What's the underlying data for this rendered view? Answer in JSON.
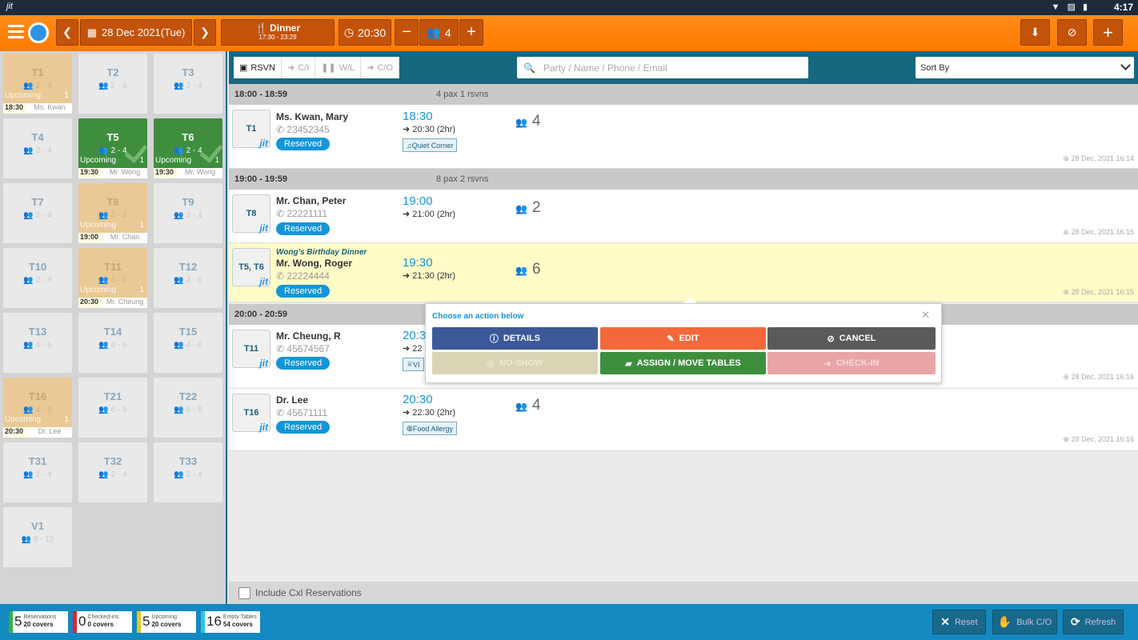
{
  "status_bar": {
    "logo": "jit",
    "time": "4:17",
    "icons": "▼ ▨ ▮"
  },
  "header": {
    "date": "28 Dec 2021(Tue)",
    "meal": "Dinner",
    "meal_hours": "17:30 - 23:29",
    "time": "20:30",
    "party_size": "4"
  },
  "tables": [
    {
      "name": "T1",
      "cap": "2 - 4",
      "state": "Upcoming",
      "count": "1",
      "time": "18:30",
      "guest": "Ms. Kwan",
      "style": "tan"
    },
    {
      "name": "T2",
      "cap": "2 - 4",
      "style": "plain"
    },
    {
      "name": "T3",
      "cap": "2 - 4",
      "style": "plain"
    },
    {
      "name": "T4",
      "cap": "2 - 4",
      "style": "plain"
    },
    {
      "name": "T5",
      "cap": "2 - 4",
      "state": "Upcoming",
      "count": "1",
      "time": "19:30",
      "guest": "Mr. Wong",
      "style": "green"
    },
    {
      "name": "T6",
      "cap": "2 - 4",
      "state": "Upcoming",
      "count": "1",
      "time": "19:30",
      "guest": "Mr. Wong",
      "style": "green"
    },
    {
      "name": "T7",
      "cap": "2 - 4",
      "style": "plain"
    },
    {
      "name": "T8",
      "cap": "2 - 4",
      "state": "Upcoming",
      "count": "1",
      "time": "19:00",
      "guest": "Mr. Chan",
      "style": "tan"
    },
    {
      "name": "T9",
      "cap": "2 - 4",
      "style": "plain"
    },
    {
      "name": "T10",
      "cap": "2 - 4",
      "style": "plain"
    },
    {
      "name": "T11",
      "cap": "4 - 6",
      "state": "Upcoming",
      "count": "1",
      "time": "20:30",
      "guest": "Mr. Cheung",
      "style": "tan"
    },
    {
      "name": "T12",
      "cap": "4 - 6",
      "style": "plain"
    },
    {
      "name": "T13",
      "cap": "4 - 6",
      "style": "plain"
    },
    {
      "name": "T14",
      "cap": "4 - 6",
      "style": "plain"
    },
    {
      "name": "T15",
      "cap": "4 - 6",
      "style": "plain"
    },
    {
      "name": "T16",
      "cap": "4 - 6",
      "state": "Upcoming",
      "count": "1",
      "time": "20:30",
      "guest": "Dr. Lee",
      "style": "tan"
    },
    {
      "name": "T21",
      "cap": "6 - 8",
      "style": "plain"
    },
    {
      "name": "T22",
      "cap": "6 - 8",
      "style": "plain"
    },
    {
      "name": "T31",
      "cap": "2 - 4",
      "style": "plain"
    },
    {
      "name": "T32",
      "cap": "2 - 4",
      "style": "plain"
    },
    {
      "name": "T33",
      "cap": "2 - 4",
      "style": "plain"
    },
    {
      "name": "V1",
      "cap": "8 - 12",
      "style": "plain"
    }
  ],
  "tabs": {
    "rsvn": "RSVN",
    "ci": "C/I",
    "wl": "W/L",
    "co": "C/O"
  },
  "search": {
    "placeholder": "Party / Name / Phone / Email"
  },
  "sort": {
    "label": "Sort By"
  },
  "groups": [
    {
      "time": "18:00 - 18:59",
      "pax": "4 pax   1 rsvns"
    },
    {
      "time": "19:00 - 19:59",
      "pax": "8 pax   2 rsvns"
    },
    {
      "time": "20:00 - 20:59",
      "pax": ""
    }
  ],
  "reservations": [
    {
      "table": "T1",
      "name": "Ms. Kwan, Mary",
      "phone": "23452345",
      "status": "Reserved",
      "time": "18:30",
      "end": "20:30 (2hr)",
      "tag": "Quiet Corner",
      "pax": "4",
      "stamp": "28 Dec, 2021 16:14"
    },
    {
      "table": "T8",
      "name": "Mr. Chan, Peter",
      "phone": "22221111",
      "status": "Reserved",
      "time": "19:00",
      "end": "21:00 (2hr)",
      "pax": "2",
      "stamp": "28 Dec, 2021 16:15"
    },
    {
      "table": "T5, T6",
      "note": "Wong's Birthday Dinner",
      "name": "Mr. Wong, Roger",
      "phone": "22224444",
      "status": "Reserved",
      "time": "19:30",
      "end": "21:30 (2hr)",
      "pax": "6",
      "stamp": "28 Dec, 2021 16:15"
    },
    {
      "table": "T11",
      "name": "Mr. Cheung, R",
      "phone": "45674567",
      "status": "Reserved",
      "time": "20:3",
      "end": "22",
      "tag": "VI",
      "stamp": "28 Dec, 2021 16:16"
    },
    {
      "table": "T16",
      "name": "Dr. Lee",
      "phone": "45671111",
      "status": "Reserved",
      "time": "20:30",
      "end": "22:30 (2hr)",
      "tag": "Food Allergy",
      "pax": "4",
      "stamp": "28 Dec, 2021 16:16"
    }
  ],
  "popup": {
    "title": "Choose an action below",
    "details": "DETAILS",
    "edit": "EDIT",
    "cancel": "CANCEL",
    "noshow": "NO-SHOW",
    "assign": "ASSIGN / MOVE TABLES",
    "checkin": "CHECK-IN",
    "colors": {
      "details": "#3b5998",
      "edit": "#f2683a",
      "cancel": "#5a5a5a",
      "noshow": "#d9d4b4",
      "assign": "#3e8e3e",
      "checkin": "#e8a5a5"
    }
  },
  "include_cxl": "Include Cxl Reservations",
  "stats": [
    {
      "num": "5",
      "label": "Reservations",
      "covers": "20 covers",
      "color": "#2fb34a"
    },
    {
      "num": "0",
      "label": "Checked-ins",
      "covers": "0 covers",
      "color": "#e0252b"
    },
    {
      "num": "5",
      "label": "Upcoming",
      "covers": "20 covers",
      "color": "#f0c419"
    },
    {
      "num": "16",
      "label": "Empty Tables",
      "covers": "54 covers",
      "color": "#29c4e8"
    }
  ],
  "footer_buttons": {
    "reset": "Reset",
    "bulk": "Bulk C/O",
    "refresh": "Refresh"
  }
}
